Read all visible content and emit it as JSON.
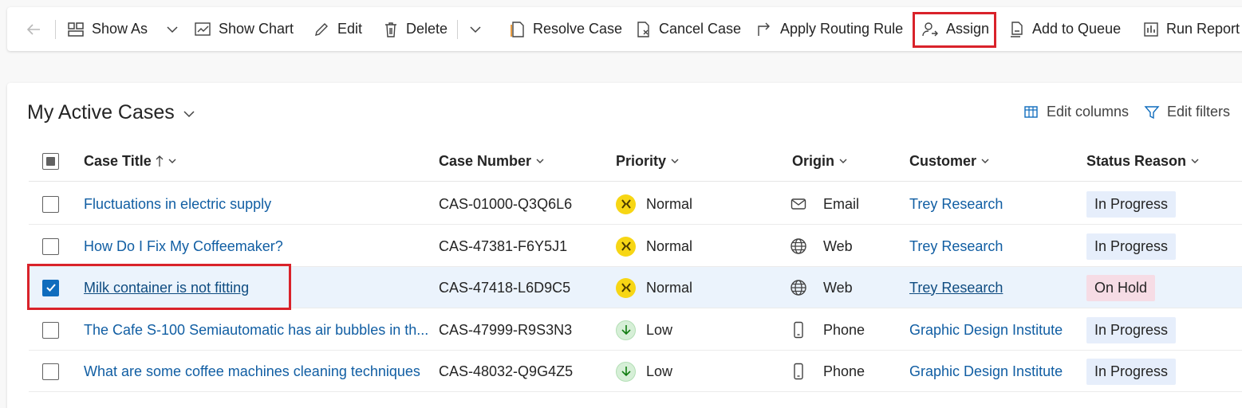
{
  "toolbar": {
    "show_as": "Show As",
    "show_chart": "Show Chart",
    "edit": "Edit",
    "delete": "Delete",
    "resolve_case": "Resolve Case",
    "cancel_case": "Cancel Case",
    "apply_routing_rule": "Apply Routing Rule",
    "assign": "Assign",
    "add_to_queue": "Add to Queue",
    "run_report": "Run Report"
  },
  "view": {
    "title": "My Active Cases",
    "edit_columns": "Edit columns",
    "edit_filters": "Edit filters"
  },
  "columns": {
    "case_title": "Case Title",
    "case_number": "Case Number",
    "priority": "Priority",
    "origin": "Origin",
    "customer": "Customer",
    "status_reason": "Status Reason"
  },
  "rows": [
    {
      "title": "Fluctuations in electric supply",
      "number": "CAS-01000-Q3Q6L6",
      "priority": "Normal",
      "priority_icon": "normal-priority-icon",
      "origin": "Email",
      "origin_icon": "mail-icon",
      "customer": "Trey Research",
      "status": "In Progress",
      "checked": false
    },
    {
      "title": "How Do I Fix My Coffeemaker?",
      "number": "CAS-47381-F6Y5J1",
      "priority": "Normal",
      "priority_icon": "normal-priority-icon",
      "origin": "Web",
      "origin_icon": "globe-icon",
      "customer": "Trey Research",
      "status": "In Progress",
      "checked": false
    },
    {
      "title": "Milk container is not fitting",
      "number": "CAS-47418-L6D9C5",
      "priority": "Normal",
      "priority_icon": "normal-priority-icon",
      "origin": "Web",
      "origin_icon": "globe-icon",
      "customer": "Trey Research",
      "status": "On Hold",
      "checked": true
    },
    {
      "title": "The Cafe S-100 Semiautomatic has air bubbles in th...",
      "number": "CAS-47999-R9S3N3",
      "priority": "Low",
      "priority_icon": "low-priority-icon",
      "origin": "Phone",
      "origin_icon": "phone-icon",
      "customer": "Graphic Design Institute",
      "status": "In Progress",
      "checked": false
    },
    {
      "title": "What are some coffee machines cleaning techniques",
      "number": "CAS-48032-Q9G4Z5",
      "priority": "Low",
      "priority_icon": "low-priority-icon",
      "origin": "Phone",
      "origin_icon": "phone-icon",
      "customer": "Graphic Design Institute",
      "status": "In Progress",
      "checked": false
    }
  ],
  "colors": {
    "accent": "#0f6cbd",
    "highlight_border": "#d9222a",
    "link": "#115ea3",
    "normal_priority": "#f7d614",
    "low_priority": "#d6efd7",
    "on_hold_badge": "#f6dce5",
    "in_progress_badge": "#e6eefb"
  }
}
